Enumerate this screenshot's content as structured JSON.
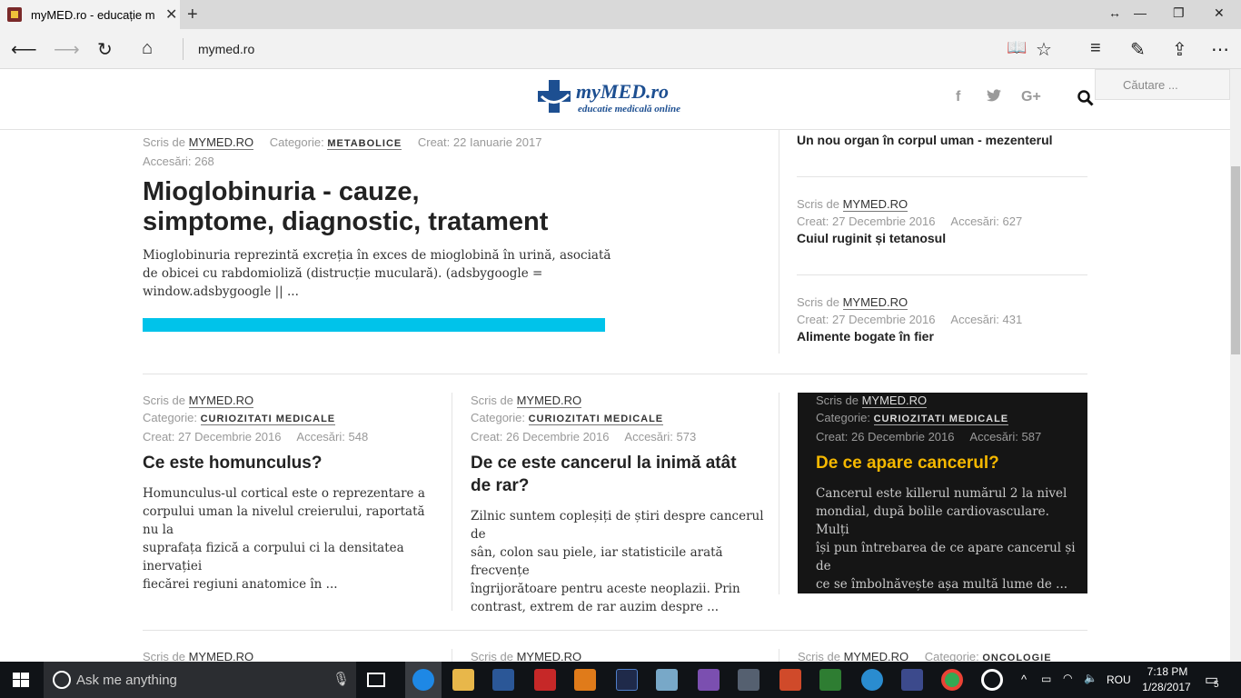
{
  "browser": {
    "tab_title": "myMED.ro - educație m",
    "address": "mymed.ro"
  },
  "site": {
    "logo_name": "myMED.ro",
    "logo_tagline": "educatie medicală online",
    "search_placeholder": "Căutare ...",
    "social": [
      "f",
      "t",
      "G+"
    ]
  },
  "labels": {
    "written_by": "Scris de",
    "category": "Categorie:",
    "created": "Creat:",
    "views": "Accesări:"
  },
  "featured": {
    "author": "MYMED.RO",
    "category": "METABOLICE",
    "created": "22 Ianuarie 2017",
    "views": "268",
    "title_line1": "Mioglobinuria - cauze,",
    "title_line2": "simptome, diagnostic, tratament",
    "excerpt_lines": [
      "Mioglobinuria reprezintă excreția în exces de mioglobină în urină, asociată",
      "de obicei cu rabdomioliză (distrucție muculară). (adsbygoogle =",
      "window.adsbygoogle || ..."
    ],
    "accent_color": "#00c3ea"
  },
  "sidebar": {
    "items": [
      {
        "title": "Un nou organ în corpul uman - mezenterul"
      },
      {
        "author": "MYMED.RO",
        "created": "27 Decembrie 2016",
        "views": "627",
        "title": "Cuiul ruginit și tetanosul"
      },
      {
        "author": "MYMED.RO",
        "created": "27 Decembrie 2016",
        "views": "431",
        "title": "Alimente bogate în fier"
      }
    ]
  },
  "cards": [
    {
      "author": "MYMED.RO",
      "category": "CURIOZITATI MEDICALE",
      "created": "27 Decembrie 2016",
      "views": "548",
      "title_lines": [
        "Ce este homunculus?"
      ],
      "excerpt_lines": [
        "Homunculus-ul cortical este o reprezentare a",
        "corpului uman la nivelul creierului, raportată nu la",
        "suprafața fizică a corpului ci la densitatea inervației",
        "fiecărei regiuni anatomice în ..."
      ]
    },
    {
      "author": "MYMED.RO",
      "category": "CURIOZITATI MEDICALE",
      "created": "26 Decembrie 2016",
      "views": "573",
      "title_lines": [
        "De ce este cancerul la inimă atât",
        "de rar?"
      ],
      "excerpt_lines": [
        "Zilnic suntem copleșiți de știri despre cancerul de",
        "sân, colon sau piele, iar statisticile arată frecvențe",
        "îngrijorătoare pentru aceste neoplazii. Prin",
        "contrast, extrem de rar auzim despre ..."
      ]
    },
    {
      "author": "MYMED.RO",
      "category": "CURIOZITATI MEDICALE",
      "created": "26 Decembrie 2016",
      "views": "587",
      "title_lines": [
        "De ce apare cancerul?"
      ],
      "excerpt_lines": [
        "Cancerul este killerul numărul 2 la nivel",
        "mondial, după bolile cardiovasculare. Mulți",
        "își pun întrebarea de ce apare cancerul și de",
        "ce se îmbolnăvește așa multă lume de ..."
      ]
    }
  ],
  "bottom_row": [
    {
      "author": "MYMED.RO"
    },
    {
      "author": "MYMED.RO"
    },
    {
      "author": "MYMED.RO",
      "category": "ONCOLOGIE"
    }
  ],
  "taskbar": {
    "search_placeholder": "Ask me anything",
    "language": "ROU",
    "time": "7:18 PM",
    "date": "1/28/2017",
    "notification_count": "5"
  }
}
